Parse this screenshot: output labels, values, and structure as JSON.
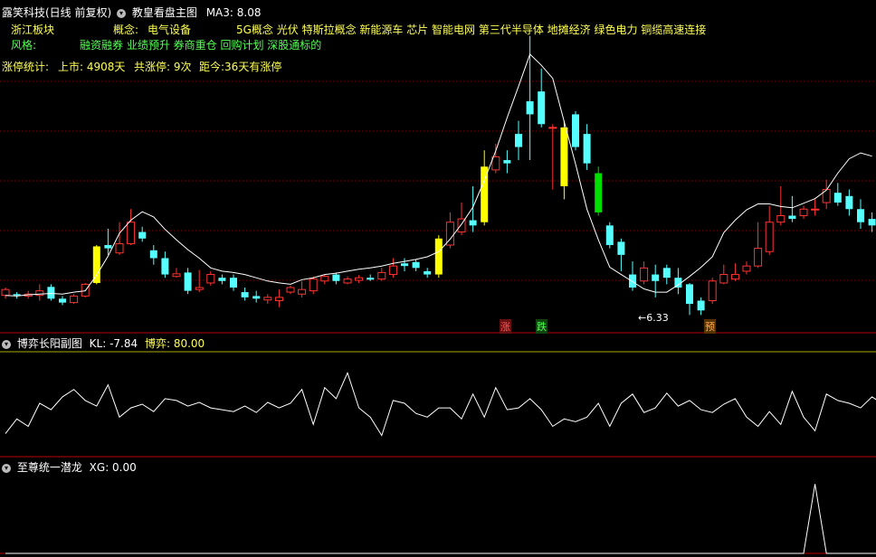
{
  "header": {
    "stock_name": "露笑科技(日线 前复权)",
    "indicator_name": "教皇看盘主图",
    "ma_text": "MA3: 8.08"
  },
  "info": {
    "sector_label": "浙江板块",
    "concept_label": "概念:",
    "concept_value": "电气设备",
    "concept_tags": "5G概念 光伏 特斯拉概念 新能源车 芯片 智能电网 第三代半导体 地摊经济 绿色电力 铜缆高速连接",
    "style_label": "风格:",
    "style_tags": "融资融券 业绩预升 券商重仓 回购计划 深股通标的",
    "limit_stats": "涨停统计:",
    "listed": "上市: 4908天",
    "limit_count": "共涨停: 9次",
    "since_last": "距今:36天有涨停"
  },
  "markers": {
    "low_price": "6.33",
    "zhang": "涨",
    "die": "跌",
    "yu": "预"
  },
  "panel2": {
    "title": "博弈长阳副图",
    "kl_text": "KL: -7.84",
    "boyi_text": "博弈: 80.00"
  },
  "panel3": {
    "title": "至尊统一潜龙",
    "xg_text": "XG: 0.00"
  },
  "colors": {
    "up_bar": "#ff3333",
    "down_bar": "#55ffff",
    "yellow_bar": "#ffff00",
    "green_bar": "#00dd00",
    "ma_line": "#ffffff",
    "grid": "#880000"
  },
  "chart_data": [
    {
      "type": "candlestick",
      "title": "教皇看盘主图",
      "series": [
        {
          "name": "MA3",
          "values": [
            6.63,
            6.62,
            6.64,
            6.65,
            6.66,
            6.65,
            6.68,
            6.7,
            6.94,
            7.23,
            7.58,
            7.78,
            7.91,
            7.83,
            7.64,
            7.48,
            7.33,
            7.2,
            7.05,
            7.0,
            6.98,
            6.95,
            6.9,
            6.85,
            6.82,
            6.8,
            6.87,
            6.9,
            6.95,
            6.97,
            7.0,
            7.03,
            7.05,
            7.08,
            7.12,
            7.15,
            7.18,
            7.22,
            7.3,
            7.49,
            7.72,
            7.98,
            8.39,
            8.84,
            9.35,
            9.83,
            10.32,
            10.15,
            9.95,
            9.29,
            8.64,
            7.95,
            7.48,
            7.06,
            6.95,
            6.84,
            6.73,
            6.68,
            6.68,
            6.79,
            6.92,
            7.06,
            7.22,
            7.59,
            7.78,
            7.94,
            8.03,
            8.03,
            7.99,
            7.97,
            8.04,
            8.11,
            8.24,
            8.5,
            8.72,
            8.81,
            8.76
          ]
        }
      ],
      "candles": [
        [
          6.63,
          6.72,
          6.58,
          6.75
        ],
        [
          6.65,
          6.63,
          6.58,
          6.68
        ],
        [
          6.62,
          6.65,
          6.58,
          6.7
        ],
        [
          6.63,
          6.7,
          6.55,
          6.8
        ],
        [
          6.76,
          6.58,
          6.55,
          6.8
        ],
        [
          6.58,
          6.52,
          6.48,
          6.62
        ],
        [
          6.52,
          6.62,
          6.5,
          6.65
        ],
        [
          6.62,
          6.8,
          6.6,
          6.82
        ],
        [
          6.82,
          7.38,
          6.8,
          7.4
        ],
        [
          7.4,
          7.35,
          7.25,
          7.65
        ],
        [
          7.28,
          7.42,
          7.25,
          7.75
        ],
        [
          7.42,
          7.75,
          7.4,
          7.95
        ],
        [
          7.6,
          7.5,
          7.45,
          7.68
        ],
        [
          7.32,
          7.2,
          7.1,
          7.4
        ],
        [
          7.2,
          6.95,
          6.9,
          7.3
        ],
        [
          6.92,
          6.96,
          6.9,
          7.05
        ],
        [
          6.98,
          6.7,
          6.65,
          7.05
        ],
        [
          6.72,
          6.75,
          6.68,
          7.02
        ],
        [
          6.82,
          6.95,
          6.78,
          7.0
        ],
        [
          6.9,
          6.85,
          6.8,
          6.95
        ],
        [
          6.9,
          6.75,
          6.7,
          6.95
        ],
        [
          6.68,
          6.6,
          6.55,
          6.75
        ],
        [
          6.62,
          6.58,
          6.52,
          6.7
        ],
        [
          6.56,
          6.6,
          6.5,
          6.65
        ],
        [
          6.55,
          6.6,
          6.45,
          6.72
        ],
        [
          6.68,
          6.75,
          6.65,
          6.78
        ],
        [
          6.65,
          6.72,
          6.6,
          6.85
        ],
        [
          6.7,
          6.88,
          6.65,
          6.92
        ],
        [
          6.85,
          6.92,
          6.8,
          6.95
        ],
        [
          6.95,
          6.85,
          6.8,
          6.98
        ],
        [
          6.82,
          6.88,
          6.8,
          6.92
        ],
        [
          6.86,
          6.9,
          6.82,
          6.94
        ],
        [
          6.9,
          6.87,
          6.85,
          6.95
        ],
        [
          6.88,
          6.98,
          6.85,
          7.05
        ],
        [
          6.95,
          7.08,
          6.9,
          7.2
        ],
        [
          7.12,
          7.08,
          7.0,
          7.2
        ],
        [
          7.14,
          7.05,
          7.0,
          7.18
        ],
        [
          7.0,
          6.95,
          6.9,
          7.05
        ],
        [
          6.95,
          7.5,
          6.9,
          7.55
        ],
        [
          7.4,
          7.75,
          7.35,
          7.9
        ],
        [
          7.6,
          7.8,
          7.55,
          8.05
        ],
        [
          7.78,
          7.7,
          7.6,
          8.3
        ],
        [
          7.75,
          8.6,
          7.7,
          8.85
        ],
        [
          8.55,
          8.75,
          8.5,
          8.95
        ],
        [
          8.7,
          8.65,
          8.5,
          8.85
        ],
        [
          9.1,
          8.9,
          8.7,
          9.3
        ],
        [
          9.6,
          9.4,
          8.7,
          10.6
        ],
        [
          9.75,
          9.25,
          9.2,
          10.1
        ],
        [
          9.2,
          9.2,
          8.25,
          9.25
        ],
        [
          8.3,
          9.2,
          8.1,
          9.3
        ],
        [
          9.4,
          8.9,
          8.85,
          9.45
        ],
        [
          9.1,
          8.65,
          8.55,
          9.25
        ],
        [
          8.5,
          7.9,
          7.85,
          8.6
        ],
        [
          7.7,
          7.4,
          7.35,
          7.75
        ],
        [
          7.45,
          7.25,
          7.0,
          7.5
        ],
        [
          6.95,
          6.75,
          6.7,
          7.15
        ],
        [
          6.85,
          7.05,
          6.8,
          7.15
        ],
        [
          6.95,
          6.85,
          6.6,
          7.1
        ],
        [
          7.05,
          6.9,
          6.8,
          7.1
        ],
        [
          6.9,
          6.75,
          6.65,
          7.05
        ],
        [
          6.8,
          6.5,
          6.33,
          6.82
        ],
        [
          6.55,
          6.4,
          6.33,
          6.6
        ],
        [
          6.55,
          6.85,
          6.5,
          6.9
        ],
        [
          6.82,
          6.95,
          6.8,
          7.1
        ],
        [
          6.88,
          6.95,
          6.85,
          7.12
        ],
        [
          7.0,
          7.08,
          6.95,
          7.15
        ],
        [
          7.08,
          7.35,
          7.05,
          7.75
        ],
        [
          7.3,
          7.75,
          7.25,
          8.0
        ],
        [
          7.75,
          7.85,
          7.7,
          8.3
        ],
        [
          7.85,
          7.8,
          7.75,
          8.15
        ],
        [
          7.85,
          7.95,
          7.8,
          8.0
        ],
        [
          7.95,
          7.95,
          7.85,
          8.1
        ],
        [
          8.05,
          8.25,
          7.95,
          8.4
        ],
        [
          8.2,
          8.05,
          8.0,
          8.35
        ],
        [
          8.15,
          7.95,
          7.85,
          8.25
        ],
        [
          7.95,
          7.75,
          7.65,
          8.1
        ],
        [
          7.8,
          7.7,
          7.6,
          7.9
        ],
        [
          7.7,
          7.95,
          7.65,
          8.05
        ],
        [
          7.95,
          8.1,
          7.9,
          8.2
        ],
        [
          8.05,
          8.2,
          8.0,
          8.3
        ]
      ],
      "ylim": [
        6.1,
        10.9
      ]
    },
    {
      "type": "line",
      "title": "博弈长阳副图",
      "series": [
        {
          "name": "KL",
          "values": [
            12,
            28,
            20,
            45,
            38,
            52,
            60,
            48,
            42,
            65,
            30,
            40,
            44,
            36,
            50,
            48,
            42,
            46,
            40,
            38,
            36,
            42,
            35,
            46,
            40,
            45,
            60,
            22,
            62,
            50,
            78,
            40,
            30,
            10,
            48,
            45,
            34,
            30,
            40,
            40,
            28,
            55,
            30,
            62,
            38,
            40,
            50,
            38,
            20,
            28,
            25,
            30,
            45,
            20,
            45,
            55,
            35,
            40,
            56,
            42,
            48,
            38,
            35,
            44,
            50,
            30,
            20,
            36,
            22,
            58,
            30,
            15,
            55,
            48,
            45,
            40,
            52,
            44,
            30,
            40,
            22
          ]
        }
      ],
      "ylim": [
        -10,
        100
      ]
    },
    {
      "type": "line",
      "title": "至尊统一潜龙",
      "series": [
        {
          "name": "XG",
          "values": [
            0,
            0,
            0,
            0,
            0,
            0,
            0,
            0,
            0,
            0,
            0,
            0,
            0,
            0,
            0,
            0,
            0,
            0,
            0,
            0,
            0,
            0,
            0,
            0,
            0,
            0,
            0,
            0,
            0,
            0,
            0,
            0,
            0,
            0,
            0,
            0,
            0,
            0,
            0,
            0,
            0,
            0,
            0,
            0,
            0,
            0,
            0,
            0,
            0,
            0,
            0,
            0,
            0,
            0,
            0,
            0,
            0,
            0,
            0,
            0,
            0,
            0,
            0,
            0,
            0,
            0,
            0,
            0,
            0,
            0,
            0,
            100,
            0,
            0,
            0,
            0,
            0,
            0,
            0,
            0,
            0
          ]
        }
      ],
      "ylim": [
        0,
        120
      ]
    }
  ]
}
